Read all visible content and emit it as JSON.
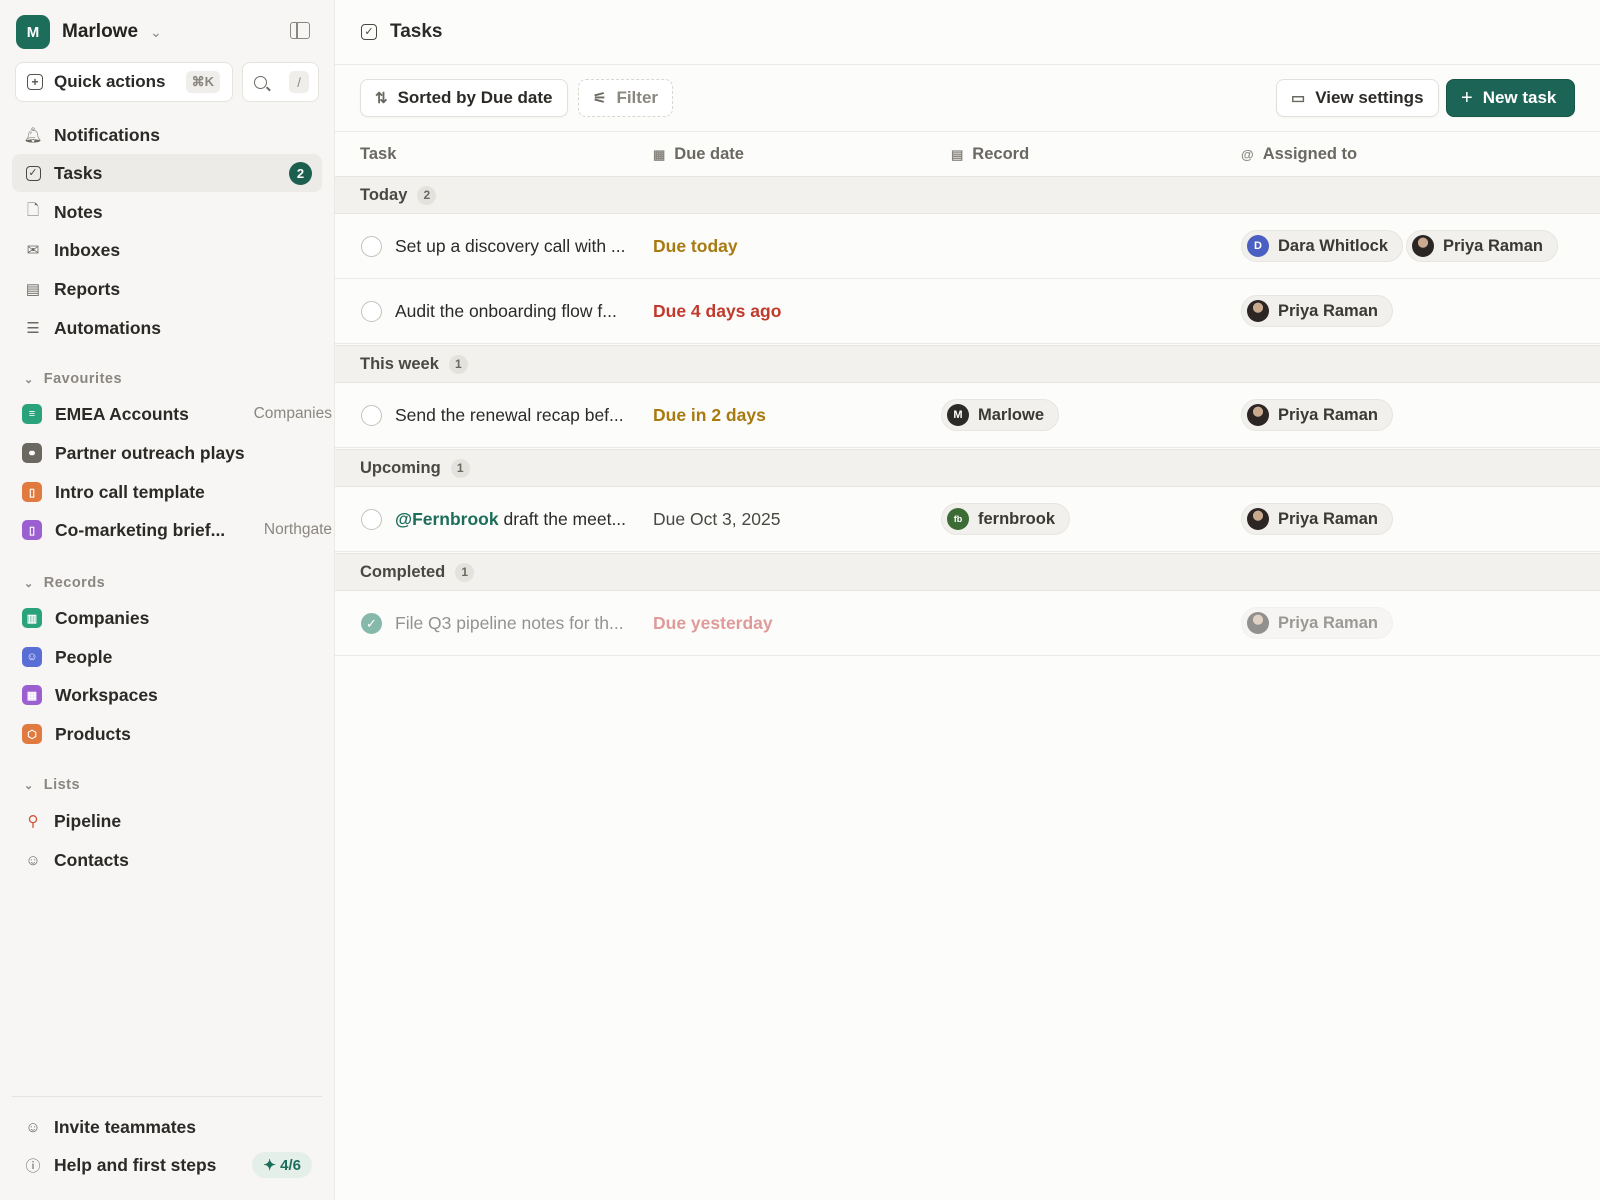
{
  "workspace": {
    "logo_letter": "M",
    "name": "Marlowe"
  },
  "sidebar": {
    "quick_actions": "Quick actions",
    "quick_actions_shortcut": "⌘K",
    "search_shortcut": "/",
    "nav": [
      {
        "label": "Notifications",
        "icon": "bell-icon"
      },
      {
        "label": "Tasks",
        "icon": "task-check-icon",
        "badge": "2",
        "active": true
      },
      {
        "label": "Notes",
        "icon": "note-icon"
      },
      {
        "label": "Inboxes",
        "icon": "mail-icon"
      },
      {
        "label": "Reports",
        "icon": "chart-icon"
      },
      {
        "label": "Automations",
        "icon": "automation-icon"
      }
    ],
    "favourites_title": "Favourites",
    "favourites": [
      {
        "label": "EMEA Accounts",
        "tag": "Companies",
        "color": "#2aa37c",
        "icon": "list-icon"
      },
      {
        "label": "Partner outreach plays",
        "tag": "",
        "color": "#6b6862",
        "icon": "workflow-icon"
      },
      {
        "label": "Intro call template",
        "tag": "",
        "color": "#e07a3f",
        "icon": "document-icon"
      },
      {
        "label": "Co-marketing brief...",
        "tag": "Northgate",
        "color": "#9b5fd1",
        "icon": "document-icon"
      }
    ],
    "records_title": "Records",
    "records": [
      {
        "label": "Companies",
        "color": "#2aa37c",
        "icon": "building-icon"
      },
      {
        "label": "People",
        "color": "#5a6fd6",
        "icon": "person-icon"
      },
      {
        "label": "Workspaces",
        "color": "#9b5fd1",
        "icon": "workspace-icon"
      },
      {
        "label": "Products",
        "color": "#e07a3f",
        "icon": "box-icon"
      }
    ],
    "lists_title": "Lists",
    "lists": [
      {
        "label": "Pipeline",
        "icon": "pin-icon"
      },
      {
        "label": "Contacts",
        "icon": "people-icon"
      }
    ],
    "invite": "Invite teammates",
    "help": "Help and first steps",
    "help_progress": "4/6"
  },
  "main": {
    "title": "Tasks",
    "sort_label": "Sorted by Due date",
    "filter_label": "Filter",
    "view_settings": "View settings",
    "new_task": "New task",
    "columns": [
      "Task",
      "Due date",
      "Record",
      "Assigned to"
    ]
  },
  "groups": [
    {
      "label": "Today",
      "count": "2"
    },
    {
      "label": "This week",
      "count": "1"
    },
    {
      "label": "Upcoming",
      "count": "1"
    },
    {
      "label": "Completed",
      "count": "1"
    }
  ],
  "tasks": [
    {
      "text": "Set up a discovery call with ...",
      "mention": "",
      "due": "Due today",
      "due_color": "#a87a0f",
      "record": "",
      "record_avatar": "",
      "assignees": [
        "Dara Whitlock",
        "Priya Raman"
      ],
      "done": false
    },
    {
      "text": "Audit the onboarding flow f...",
      "mention": "",
      "due": "Due 4 days ago",
      "due_color": "#c0392b",
      "record": "",
      "record_avatar": "",
      "assignees": [
        "Priya Raman"
      ],
      "done": false
    },
    {
      "text": "Send the renewal recap bef...",
      "mention": "",
      "due": "Due in 2 days",
      "due_color": "#a87a0f",
      "record": "Marlowe",
      "record_avatar": "M",
      "assignees": [
        "Priya Raman"
      ],
      "done": false
    },
    {
      "text": " draft the meet...",
      "mention": "@Fernbrook",
      "due": "Due Oct 3, 2025",
      "due_color": "#4a4843",
      "record": "fernbrook",
      "record_avatar": "fb",
      "assignees": [
        "Priya Raman"
      ],
      "done": true
    },
    {
      "text": "File Q3 pipeline notes for th...",
      "mention": "",
      "due": "Due yesterday",
      "due_color": "#e09a9a",
      "record": "",
      "record_avatar": "",
      "assignees": [
        "Priya Raman"
      ],
      "done": true
    }
  ],
  "avatars": {
    "Dara Whitlock": "D"
  }
}
